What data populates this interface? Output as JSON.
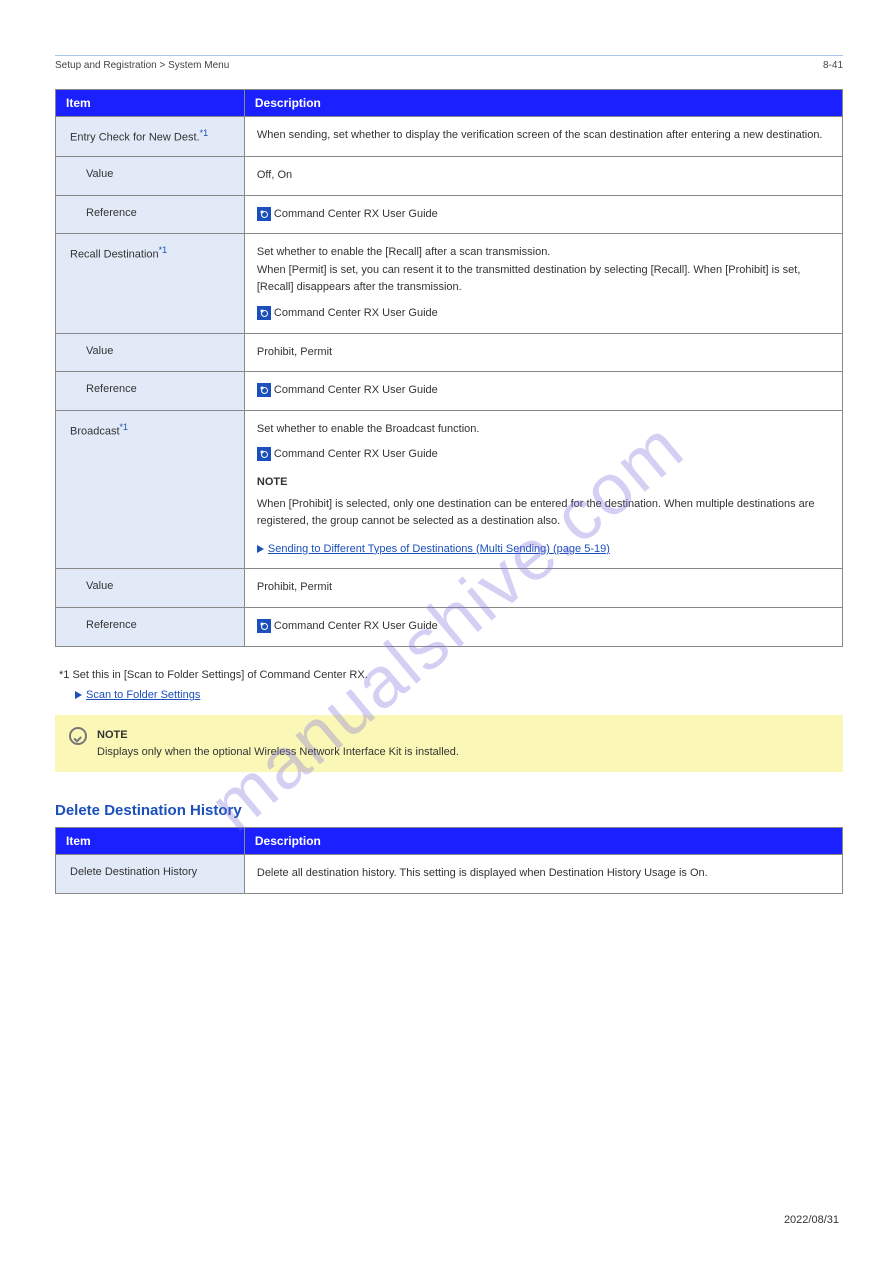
{
  "header": {
    "left": "Setup and Registration > System Menu",
    "right": "8-41"
  },
  "table1": {
    "head_item": "Item",
    "head_desc": "Description",
    "rows": [
      {
        "label": "Entry Check for New Dest.",
        "desc": "When sending, set whether to display the verification screen of the scan destination after entering a new destination.",
        "sub": [
          {
            "k": "Value",
            "v": "Off, On"
          },
          {
            "k": "Reference",
            "v_pre": "",
            "v_link": " Command Center RX User Guide"
          }
        ]
      },
      {
        "label": "Recall Destination",
        "desc_top": "Set whether to enable the [Recall] after a scan transmission.\nWhen [Permit] is set, you can resent it to the transmitted destination by selecting [Recall]. When [Prohibit] is set, [Recall] disappears after the transmission.",
        "ref_top": " Command Center RX User Guide",
        "sub": [
          {
            "k": "Value",
            "v": "Prohibit, Permit"
          },
          {
            "k": "Reference",
            "v_pre": "",
            "v_link": " Command Center RX User Guide"
          }
        ]
      },
      {
        "label": "Broadcast",
        "desc_top": "Set whether to enable the Broadcast function.",
        "ref_top": " Command Center RX User Guide",
        "note_label": "NOTE",
        "note_body": "When [Prohibit] is selected, only one destination can be entered for the destination. When multiple destinations are registered, the group cannot be selected as a destination also.",
        "arrow_link": "Sending to Different Types of Destinations (Multi Sending) (page 5-19)",
        "sub": [
          {
            "k": "Value",
            "v": "Prohibit, Permit"
          },
          {
            "k": "Reference",
            "v_pre": "",
            "v_link": " Command Center RX User Guide"
          }
        ]
      }
    ]
  },
  "asterisk": "*1 Set this in [Scan to Folder Settings] of Command Center RX.",
  "asterisk_link": "Scan to Folder Settings",
  "notebox": "Displays only when the optional Wireless Network Interface Kit is installed.",
  "section2_title": "Delete Destination History",
  "table2": {
    "head_item": "Item",
    "head_desc": "Description",
    "row_label": "Delete Destination History",
    "row_desc": "Delete all destination history. This setting is displayed when Destination History Usage is On."
  },
  "footer": "2022/08/31",
  "watermark": "manualshive.com"
}
